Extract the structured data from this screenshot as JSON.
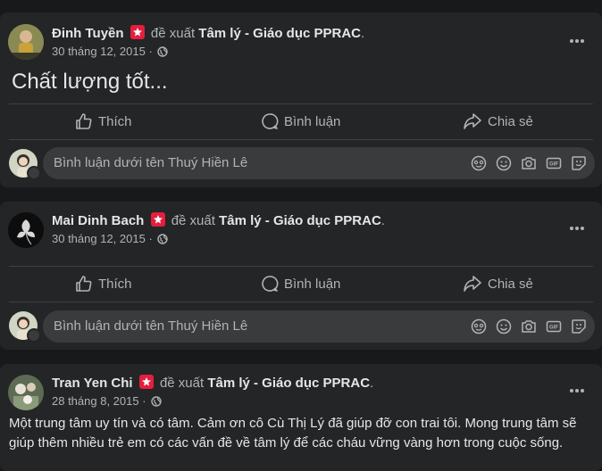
{
  "posts": [
    {
      "author": "Đinh Tuyền",
      "verb": "đề xuất",
      "page": "Tâm lý - Giáo dục PPRAC",
      "date": "30 tháng 12, 2015",
      "text": "Chất lượng tốt...",
      "actions": {
        "like": "Thích",
        "comment": "Bình luận",
        "share": "Chia sẻ"
      },
      "comment_placeholder": "Bình luận dưới tên Thuý Hiền Lê"
    },
    {
      "author": "Mai Dinh Bach",
      "verb": "đề xuất",
      "page": "Tâm lý - Giáo dục PPRAC",
      "date": "30 tháng 12, 2015",
      "text": "",
      "actions": {
        "like": "Thích",
        "comment": "Bình luận",
        "share": "Chia sẻ"
      },
      "comment_placeholder": "Bình luận dưới tên Thuý Hiền Lê"
    },
    {
      "author": "Tran Yen Chi",
      "verb": "đề xuất",
      "page": "Tâm lý - Giáo dục PPRAC",
      "date": "28 tháng 8, 2015",
      "text_line1": "Một trung tâm uy tín và có tâm. Cảm ơn cô Cù Thị Lý đã giúp đỡ con trai tôi. Mong trung tâm sẽ",
      "text_line2": "giúp thêm nhiều trẻ em có các vấn đề về tâm lý để các cháu vững vàng hơn trong cuộc sống."
    }
  ],
  "icons": [
    "recommend-badge-icon",
    "globe-icon",
    "more-icon",
    "like-icon",
    "comment-icon",
    "share-icon",
    "avatar-sticker-icon",
    "emoji-icon",
    "camera-icon",
    "gif-icon",
    "sticker-icon"
  ]
}
